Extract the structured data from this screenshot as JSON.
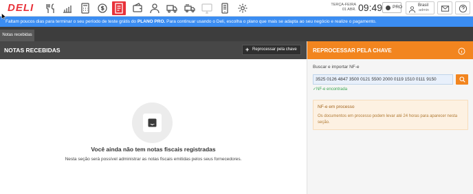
{
  "app": {
    "logo_text": "DELI"
  },
  "header": {
    "date_line1": "TERÇA-FEIRA",
    "date_line2": "01 ABR.",
    "time": "09:49",
    "plan_badge": "PRO",
    "user_location": "Brasil",
    "user_role": "admin"
  },
  "nav_icons": [
    "fork-knife-icon",
    "chart-icon",
    "calculator-icon",
    "money-icon",
    "invoice-icon",
    "wallet-icon",
    "chef-icon",
    "truck-icon",
    "delivery-icon",
    "monitor-icon",
    "mobile-icon",
    "gear-icon"
  ],
  "trial_banner": {
    "prefix": "Faltam poucos dias para terminar o seu período de teste grátis do ",
    "plan": "PLANO PRO.",
    "suffix": " Para continuar usando o Deli, escolha o plano que mais se adapta ao seu negócio e realize o pagamento."
  },
  "tabs": [
    {
      "label": "Notas recebidas",
      "active": true
    }
  ],
  "left_panel": {
    "title": "NOTAS RECEBIDAS",
    "reprocess_button": "Reprocessar pela chave",
    "empty_title": "Você ainda não tem notas fiscais registradas",
    "empty_description": "Nesta seção será possível administrar as notas fiscais emitidas pelos seus fornecedores."
  },
  "right_panel": {
    "title": "REPROCESSAR PELA CHAVE",
    "search_label": "Buscar e importar NF-e",
    "key_value": "3525 0126 4847 3500 0121 5500 2000 0119 1510 0111 9150",
    "found_text": "NF-e encontrada",
    "notice_title": "NF-e em processo",
    "notice_text": "Os documentos em processo podem levar até 24 horas para aparecer nesta seção."
  },
  "colors": {
    "brand_red": "#e8323a",
    "accent_orange": "#f2851f",
    "banner_blue": "#3b8df2",
    "success_green": "#3aa655"
  }
}
